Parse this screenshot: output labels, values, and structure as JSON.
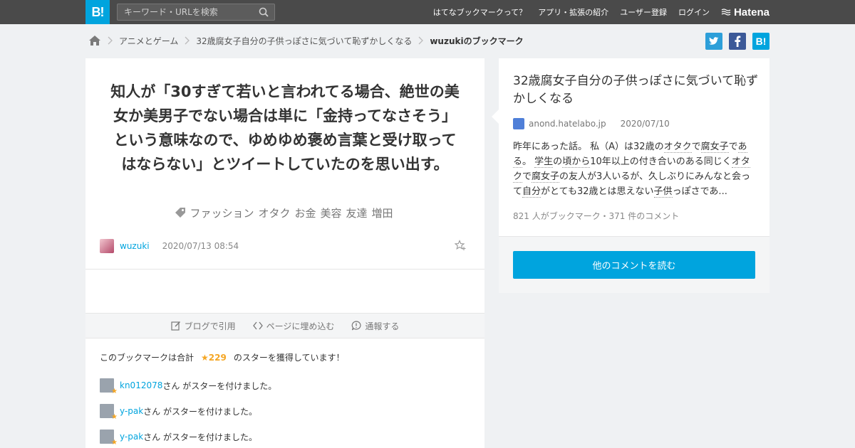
{
  "header": {
    "logo": "B!",
    "search_placeholder": "キーワード・URLを検索",
    "nav": [
      "はてなブックマークって？",
      "アプリ・拡張の紹介",
      "ユーザー登録",
      "ログイン"
    ],
    "hatena": "Hatena"
  },
  "breadcrumb": {
    "items": [
      "アニメとゲーム",
      "32歳腐女子自分の子供っぽさに気づいて恥ずかしくなる"
    ],
    "current": "wuzukiのブックマーク"
  },
  "share": {
    "bookmark_label": "B!"
  },
  "bookmark": {
    "comment": "知人が「30すぎて若いと言われてる場合、絶世の美女か美男子でない場合は単に「金持ってなさそう」という意味なので、ゆめゆめ褒め言葉と受け取ってはならない」とツイートしていたのを思い出す。",
    "tags": [
      "ファッション",
      "オタク",
      "お金",
      "美容",
      "友達",
      "増田"
    ],
    "user": "wuzuki",
    "datetime": "2020/07/13 08:54"
  },
  "toolbar": {
    "blog": "ブログで引用",
    "embed": "ページに埋め込む",
    "report": "通報する"
  },
  "stars": {
    "prefix": "このブックマークは合計",
    "total": "★229",
    "suffix": "のスターを獲得しています！",
    "entries": [
      {
        "name": "kn012078",
        "text": "さん がスターを付けました。"
      },
      {
        "name": "y-pak",
        "text": "さん がスターを付けました。"
      },
      {
        "name": "y-pak",
        "text": "さん がスターを付けました。"
      }
    ]
  },
  "entry": {
    "title": "32歳腐女子自分の子供っぽさに気づいて恥ずかしくなる",
    "domain": "anond.hatelabo.jp",
    "date": "2020/07/10",
    "counts": "821 人がブックマーク・371 件のコメント",
    "read_more": "他のコメントを読む"
  },
  "colors": {
    "accent": "#00a4de",
    "header": "#4a4a4a",
    "star": "#f5a623"
  }
}
